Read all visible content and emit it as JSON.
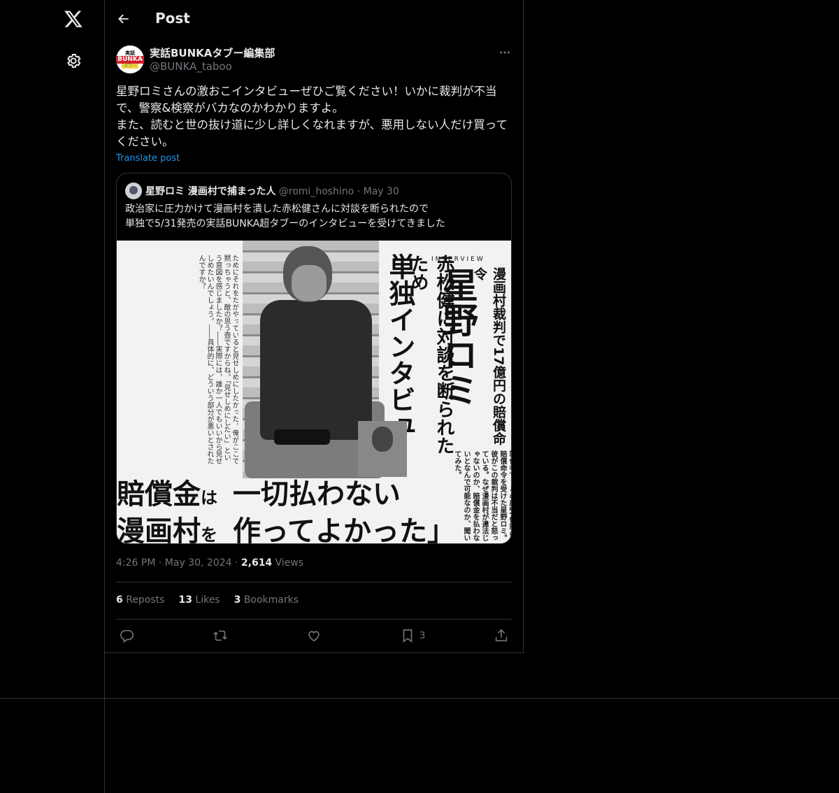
{
  "nav": {
    "logo_icon": "x-logo-icon",
    "settings_icon": "gear-icon"
  },
  "header": {
    "back_icon": "arrow-left-icon",
    "title": "Post"
  },
  "post": {
    "avatar_text": [
      "実話",
      "BUNKA",
      "タブー"
    ],
    "author_name": "実話BUNKAタブー編集部",
    "author_handle": "@BUNKA_taboo",
    "more_icon": "more-horizontal-icon",
    "text": "星野ロミさんの激おこインタビューぜひご覧ください！いかに裁判が不当で、警察&検察がバカなのかわかりますよ。\nまた、読むと世の抜け道に少し詳しくなれますが、悪用しない人だけ買ってください。",
    "translate_label": "Translate post",
    "time": "4:26 PM",
    "date": "May 30, 2024",
    "views_count": "2,614",
    "views_label": "Views",
    "separator": "·"
  },
  "quote": {
    "author_name": "星野ロミ 漫画村で捕まった人",
    "author_handle": "@romi_hoshino",
    "separator": "·",
    "date": "May 30",
    "text": "政治家に圧力かけて漫画村を潰した赤松健さんに対談を断られたので\n単独で5/31発売の実話BUNKA超タブーのインタビューを受けてきました",
    "image": {
      "interview_label": "INTERVIEW",
      "headline_name": "星野ロミ",
      "subhead": "漫画村裁判で17億円の賠償命令",
      "vertical_white": "赤松健に対談を断られたため",
      "vertical_black": "単独インタビュー",
      "bottom_line1_a": "賠償金",
      "bottom_line1_b": "は",
      "bottom_line1_c": "一切払わない",
      "bottom_line2_a": "漫画村",
      "bottom_line2_b": "を",
      "bottom_line2_c": "作ってよかった」",
      "right_caption": "世間を騒がせた「漫画村」の製作者で、この度17億円の賠償命令を受けた星野ロミ。彼がこの裁判は不当だと怒っている。なぜ漫画村が違法じゃないのか、賠償金を払わないとなんで可能なのか、聞いてみた。"
    }
  },
  "stats": {
    "reposts_count": "6",
    "reposts_label": "Reposts",
    "likes_count": "13",
    "likes_label": "Likes",
    "bookmarks_count": "3",
    "bookmarks_label": "Bookmarks"
  },
  "actions": {
    "reply_icon": "reply-icon",
    "repost_icon": "repost-icon",
    "like_icon": "heart-icon",
    "bookmark_icon": "bookmark-icon",
    "bookmark_count": "3",
    "share_icon": "share-icon"
  }
}
